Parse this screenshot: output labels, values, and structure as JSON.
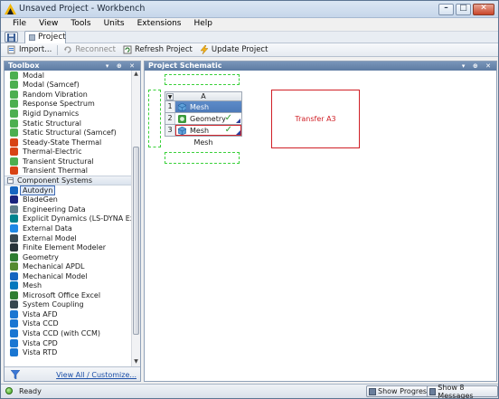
{
  "window": {
    "title": "Unsaved Project - Workbench"
  },
  "menu": [
    "File",
    "View",
    "Tools",
    "Units",
    "Extensions",
    "Help"
  ],
  "tab": {
    "label": "Project"
  },
  "toolbar": {
    "import_label": "Import...",
    "reconnect_label": "Reconnect",
    "refresh_label": "Refresh Project",
    "update_label": "Update Project"
  },
  "toolbox": {
    "title": "Toolbox",
    "analysis_items": [
      {
        "label": "Modal",
        "icon": "modal-icon",
        "color": "#4caf50"
      },
      {
        "label": "Modal (Samcef)",
        "icon": "modal-samcef-icon",
        "color": "#4caf50"
      },
      {
        "label": "Random Vibration",
        "icon": "random-vibration-icon",
        "color": "#4caf50"
      },
      {
        "label": "Response Spectrum",
        "icon": "response-spectrum-icon",
        "color": "#4caf50"
      },
      {
        "label": "Rigid Dynamics",
        "icon": "rigid-dynamics-icon",
        "color": "#4caf50"
      },
      {
        "label": "Static Structural",
        "icon": "static-structural-icon",
        "color": "#4caf50"
      },
      {
        "label": "Static Structural (Samcef)",
        "icon": "static-structural-samcef-icon",
        "color": "#4caf50"
      },
      {
        "label": "Steady-State Thermal",
        "icon": "steady-state-thermal-icon",
        "color": "#d84315"
      },
      {
        "label": "Thermal-Electric",
        "icon": "thermal-electric-icon",
        "color": "#d84315"
      },
      {
        "label": "Transient Structural",
        "icon": "transient-structural-icon",
        "color": "#4caf50"
      },
      {
        "label": "Transient Thermal",
        "icon": "transient-thermal-icon",
        "color": "#d84315"
      }
    ],
    "group_label": "Component Systems",
    "component_items": [
      {
        "label": "Autodyn",
        "icon": "autodyn-icon",
        "color": "#1565c0"
      },
      {
        "label": "BladeGen",
        "icon": "bladegen-icon",
        "color": "#1a237e"
      },
      {
        "label": "Engineering Data",
        "icon": "engineering-data-icon",
        "color": "#607d8b"
      },
      {
        "label": "Explicit Dynamics (LS-DYNA Export)",
        "icon": "explicit-dynamics-icon",
        "color": "#00838f"
      },
      {
        "label": "External Data",
        "icon": "external-data-icon",
        "color": "#1e88e5"
      },
      {
        "label": "External Model",
        "icon": "external-model-icon",
        "color": "#37474f"
      },
      {
        "label": "Finite Element Modeler",
        "icon": "finite-element-modeler-icon",
        "color": "#263238"
      },
      {
        "label": "Geometry",
        "icon": "geometry-icon",
        "color": "#2e7d32"
      },
      {
        "label": "Mechanical APDL",
        "icon": "mechanical-apdl-icon",
        "color": "#558b2f"
      },
      {
        "label": "Mechanical Model",
        "icon": "mechanical-model-icon",
        "color": "#1565c0"
      },
      {
        "label": "Mesh",
        "icon": "mesh-icon",
        "color": "#0277bd"
      },
      {
        "label": "Microsoft Office Excel",
        "icon": "excel-icon",
        "color": "#2e7d32"
      },
      {
        "label": "System Coupling",
        "icon": "system-coupling-icon",
        "color": "#37474f"
      },
      {
        "label": "Vista AFD",
        "icon": "vista-afd-icon",
        "color": "#1976d2"
      },
      {
        "label": "Vista CCD",
        "icon": "vista-ccd-icon",
        "color": "#1976d2"
      },
      {
        "label": "Vista CCD (with CCM)",
        "icon": "vista-ccd-ccm-icon",
        "color": "#1976d2"
      },
      {
        "label": "Vista CPD",
        "icon": "vista-cpd-icon",
        "color": "#1976d2"
      },
      {
        "label": "Vista RTD",
        "icon": "vista-rtd-icon",
        "color": "#1976d2"
      }
    ],
    "view_all_label": "View All / Customize..."
  },
  "schematic": {
    "title": "Project Schematic",
    "system": {
      "column_letter": "A",
      "rows": [
        {
          "num": "1",
          "label": "Mesh",
          "icon": "mesh-icon",
          "check": ""
        },
        {
          "num": "2",
          "label": "Geometry",
          "icon": "geometry-icon",
          "check": "✓"
        },
        {
          "num": "3",
          "label": "Mesh",
          "icon": "mesh-icon",
          "check": "✓"
        }
      ],
      "name": "Mesh"
    },
    "transfer_label": "Transfer A3"
  },
  "status": {
    "text": "Ready",
    "show_progress_label": "Show Progress",
    "show_messages_label": "Show 8 Messages"
  }
}
